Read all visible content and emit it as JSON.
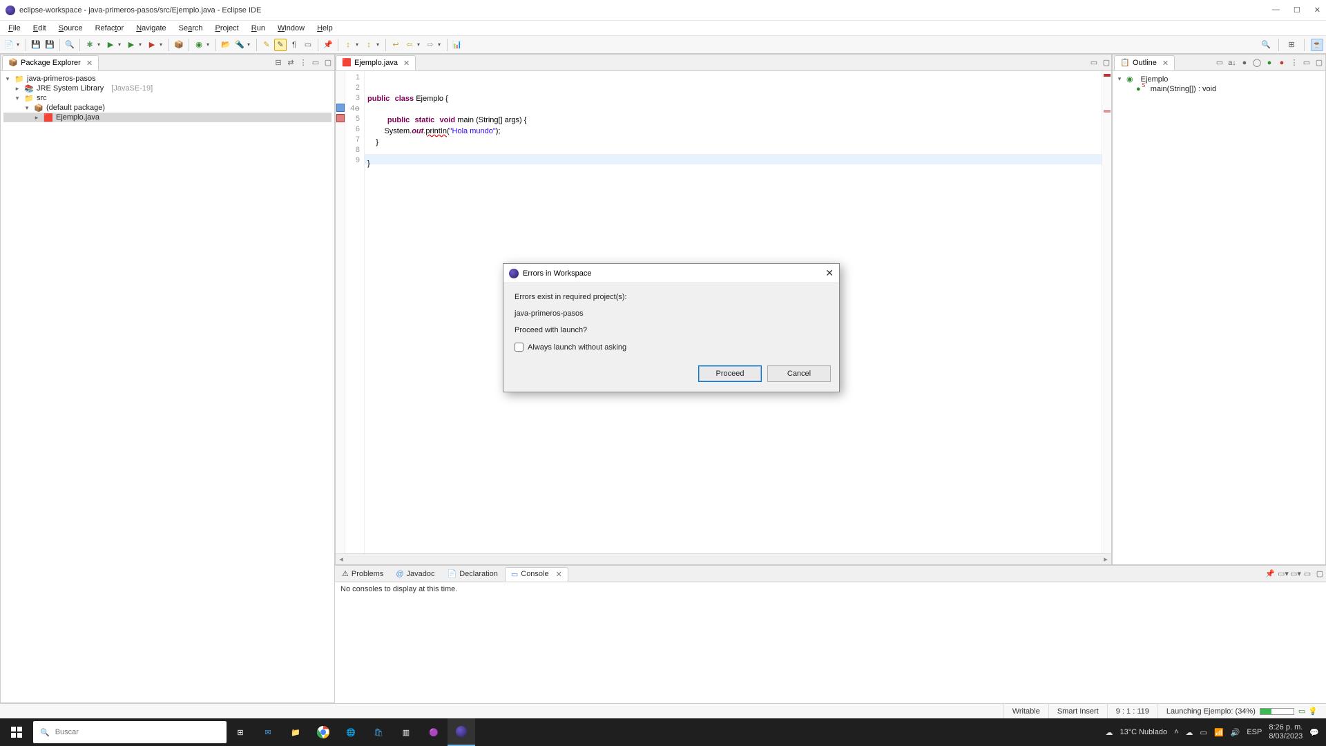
{
  "window": {
    "title": "eclipse-workspace - java-primeros-pasos/src/Ejemplo.java - Eclipse IDE"
  },
  "menu": [
    "File",
    "Edit",
    "Source",
    "Refactor",
    "Navigate",
    "Search",
    "Project",
    "Run",
    "Window",
    "Help"
  ],
  "package_explorer": {
    "title": "Package Explorer",
    "project": "java-primeros-pasos",
    "jre": "JRE System Library",
    "jre_ver": "[JavaSE-19]",
    "src": "src",
    "pkg": "(default package)",
    "file": "Ejemplo.java"
  },
  "editor": {
    "tab": "Ejemplo.java",
    "lines": [
      "1",
      "2",
      "3",
      "4",
      "5",
      "6",
      "7",
      "8",
      "9"
    ],
    "l4_marker": "⊖",
    "code": {
      "l2_a": "public",
      "l2_b": "class",
      "l2_c": " Ejemplo {",
      "l4_a": "public",
      "l4_b": "static",
      "l4_c": "void",
      "l4_d": " main (String[] args) {",
      "l5_a": "        System.",
      "l5_b": "out",
      "l5_c": ".",
      "l5_d": "printIn",
      "l5_e": "(",
      "l5_f": "\"Hola mundo\"",
      "l5_g": ");",
      "l6": "    }",
      "l8": "}"
    }
  },
  "outline": {
    "title": "Outline",
    "cls": "Ejemplo",
    "method": "main(String[]) : void",
    "method_badge": "S"
  },
  "bottom": {
    "tabs": {
      "problems": "Problems",
      "javadoc": "Javadoc",
      "declaration": "Declaration",
      "console": "Console"
    },
    "console_msg": "No consoles to display at this time."
  },
  "status": {
    "writable": "Writable",
    "insert": "Smart Insert",
    "pos": "9 : 1 : 119",
    "launch": "Launching Ejemplo: (34%)"
  },
  "dialog": {
    "title": "Errors in Workspace",
    "msg1": "Errors exist in required project(s):",
    "msg2": "java-primeros-pasos",
    "msg3": "Proceed with launch?",
    "checkbox": "Always launch without asking",
    "proceed": "Proceed",
    "cancel": "Cancel"
  },
  "taskbar": {
    "search_placeholder": "Buscar",
    "weather": "13°C  Nublado",
    "lang": "ESP",
    "time": "8:26 p. m.",
    "date": "8/03/2023"
  }
}
